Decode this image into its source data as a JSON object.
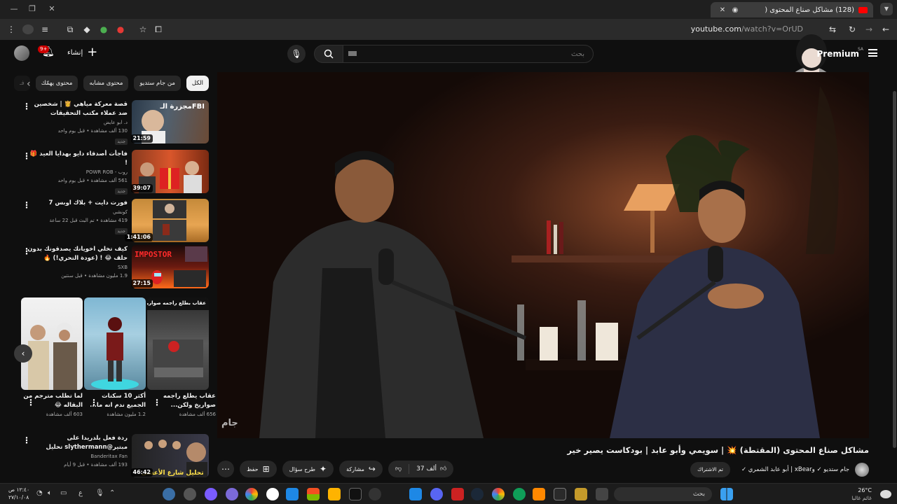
{
  "browser": {
    "tab_title": "(128) مشاكل صناع المحتوى (",
    "url_domain": "youtube.com",
    "url_path": "/watch?v=OrUD"
  },
  "masthead": {
    "create_label": "إنشاء",
    "notification_count": "9+",
    "search_placeholder": "بحث",
    "premium_label": "Premium",
    "premium_region": "SA"
  },
  "chips": [
    "الكل",
    "من جام ستديو",
    "محتوى مشابه",
    "محتوى يهمّك",
    "فـ"
  ],
  "recommendations": [
    {
      "title": "قصة معركة مياهي 👸 | شخصين ضد عملاء مكتب التحقيقات الفيدرالي!",
      "channel": "د. ابو عايض",
      "meta": "130 ألف مشاهدة • قبل يوم واحد",
      "badge": "جديد",
      "duration": "21:59",
      "thumb_text": "مجزرة الـFBI"
    },
    {
      "title": "فاجأت أصدقاء دايو بهدايا العيد 🎁 !",
      "channel": "روب - POWR ROB",
      "meta": "561 ألف مشاهدة • قبل يوم واحد",
      "badge": "جديد",
      "duration": "39:07",
      "thumb_text": ""
    },
    {
      "title": "فورت دايت + بلاك اوبس 7",
      "channel": "كونشي",
      "meta": "419 مشاهدة • تم البث قبل 22 ساعة",
      "badge": "جديد",
      "duration": "1:41:06",
      "thumb_text": ""
    },
    {
      "title": "كيف تخلي اخويانك يصدقونك بدون حلف 😂 ! (عودة التحري!) 🔥",
      "channel": "SXB",
      "meta": "1.9 مليون مشاهدة • قبل سنتين",
      "badge": "",
      "duration": "27:15",
      "thumb_text": "IMPOSTOR"
    },
    {
      "title": "ردة فعل بلدريدا على مبتير@slythermann تحليل مسلسل شا...",
      "channel": "Banderitax Fan",
      "meta": "193 ألف مشاهدة • قبل 9 أيام",
      "badge": "",
      "duration": "46:42",
      "thumb_text": "تحليل شارع الأعشى"
    }
  ],
  "shorts": [
    {
      "title": "عقاب بطلع راجمه صواريخ 🔥",
      "overlay": "عقاب بطلع راجمه صواريخ",
      "meta": ""
    },
    {
      "title": "عقاب يطلع راجمه صواريخ ولكن...",
      "meta": "656 ألف مشاهدة"
    },
    {
      "title": "أكثر 10 سكنات الجميع ندم انه ما...",
      "meta": "1.2 مليون مشاهدة"
    },
    {
      "title": "لما تطلب مترجم من البقاله 😂",
      "meta": "603 ألف مشاهدة"
    }
  ],
  "video": {
    "title": "مشاكل صناع المحتوى (المقتطة) 💥 | سويمي وأبو عابد | بودكاست يصير خير",
    "channel": "جام ستديو ✓ وxBear | أبو عابد الشمري ✓",
    "subscribe_label": "تم الاشتراك",
    "likes": "37 ألف",
    "share_label": "مشاركة",
    "ask_label": "طرح سؤال",
    "save_label": "حفظ",
    "watermark": "جام"
  },
  "taskbar": {
    "search_placeholder": "بحث",
    "weather_temp": "26°C",
    "weather_desc": "غائم غالبا",
    "time": "١٢:٤٠ ص",
    "date": "٢٧/١٠/٠٨",
    "lang": "ع"
  },
  "colors": {
    "background": "#0f0f0f",
    "accent_red": "#ff0000",
    "chip_bg": "#272727"
  }
}
